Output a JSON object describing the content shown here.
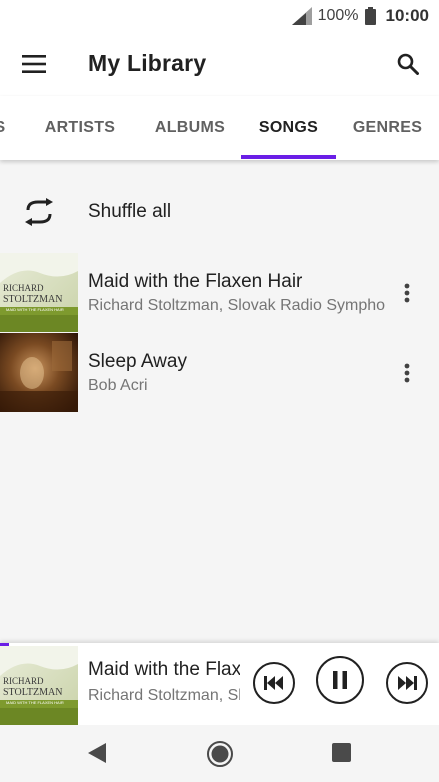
{
  "status_bar": {
    "battery": "100%",
    "time": "10:00"
  },
  "header": {
    "title": "My Library",
    "icons": [
      "menu-icon",
      "search-icon"
    ]
  },
  "tabs": {
    "items": [
      {
        "label": "S"
      },
      {
        "label": "ARTISTS"
      },
      {
        "label": "ALBUMS"
      },
      {
        "label": "SONGS"
      },
      {
        "label": "GENRES"
      }
    ],
    "active": "SONGS",
    "indicator_color": "#6a1ee6"
  },
  "shuffle": {
    "label": "Shuffle all"
  },
  "songs": [
    {
      "title": "Maid with the Flaxen Hair",
      "artist": "Richard Stoltzman, Slovak Radio Symphony Orchestra",
      "art_lines": [
        "RICHARD",
        "STOLTZMAN",
        "MAID WITH THE FLAXEN HAIR"
      ]
    },
    {
      "title": "Sleep Away",
      "artist": "Bob Acri"
    }
  ],
  "now_playing": {
    "title": "Maid with the Flaxen Hair",
    "artist": "Richard Stoltzman, Slovak Radio Symphony Orchestra",
    "progress_fraction": 0.02,
    "controls": [
      "previous-icon",
      "pause-icon",
      "next-icon"
    ]
  },
  "colors": {
    "accent": "#6a1ee6",
    "background": "#f5f5f5",
    "surface": "#ffffff"
  }
}
